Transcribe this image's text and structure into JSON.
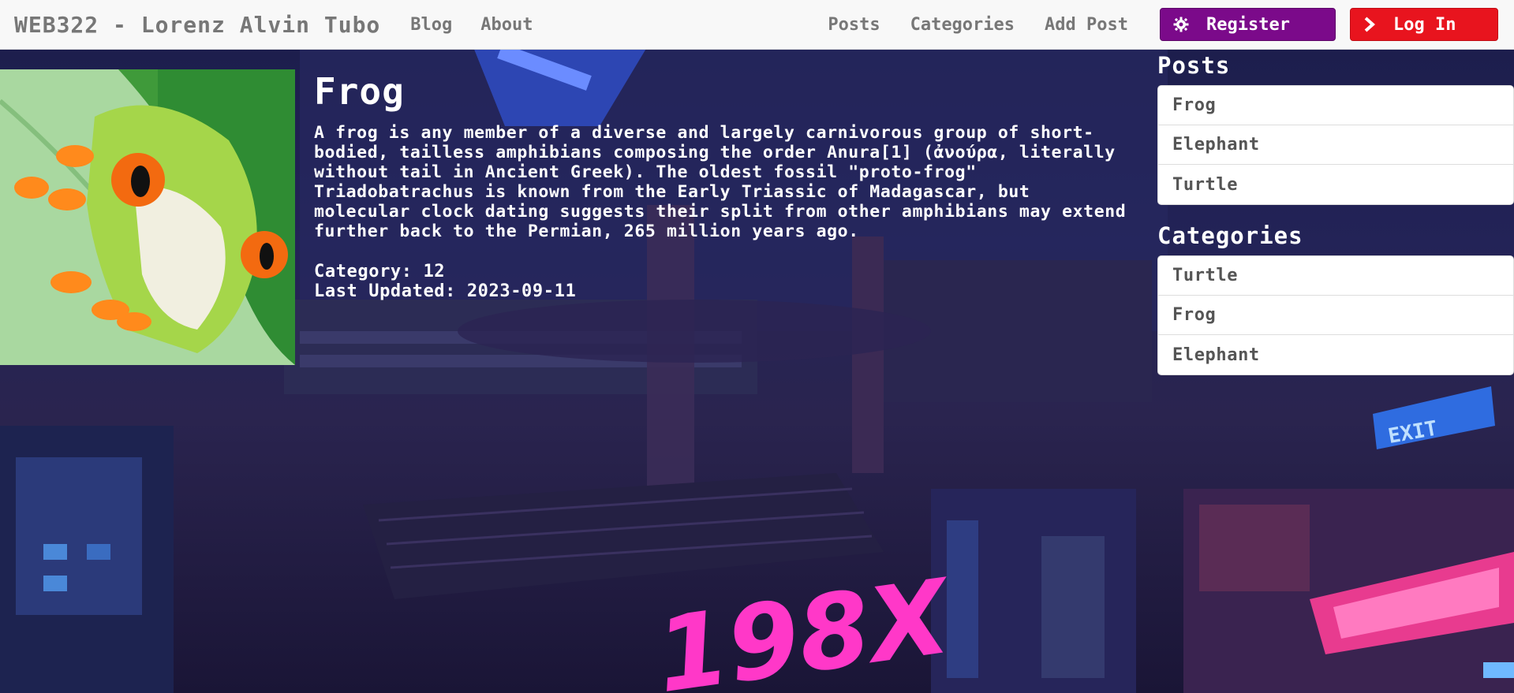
{
  "navbar": {
    "brand": "WEB322 - Lorenz Alvin Tubo",
    "left_links": [
      "Blog",
      "About"
    ],
    "right_links": [
      "Posts",
      "Categories",
      "Add Post"
    ],
    "register_label": "Register",
    "register_icon": "gear-icon",
    "login_label": "Log In",
    "login_icon": "chevron-right-icon",
    "register_color": "#7b0a8a",
    "login_color": "#e8141e"
  },
  "post": {
    "image": "frog-photo",
    "title": "Frog",
    "body": "A frog is any member of a diverse and largely carnivorous group of short-bodied, tailless amphibians composing the order Anura[1] (ἀνούρα, literally without tail in Ancient Greek). The oldest fossil \"proto-frog\" Triadobatrachus is known from the Early Triassic of Madagascar, but molecular clock dating suggests their split from other amphibians may extend further back to the Permian, 265 million years ago.",
    "category_line": "Category: 12",
    "updated_line": "Last Updated: 2023-09-11"
  },
  "sidebar": {
    "posts_heading": "Posts",
    "posts": [
      "Frog",
      "Elephant",
      "Turtle"
    ],
    "categories_heading": "Categories",
    "categories": [
      "Turtle",
      "Frog",
      "Elephant"
    ]
  },
  "background": {
    "sign_text": "198X",
    "exit_sign": "EXIT"
  }
}
